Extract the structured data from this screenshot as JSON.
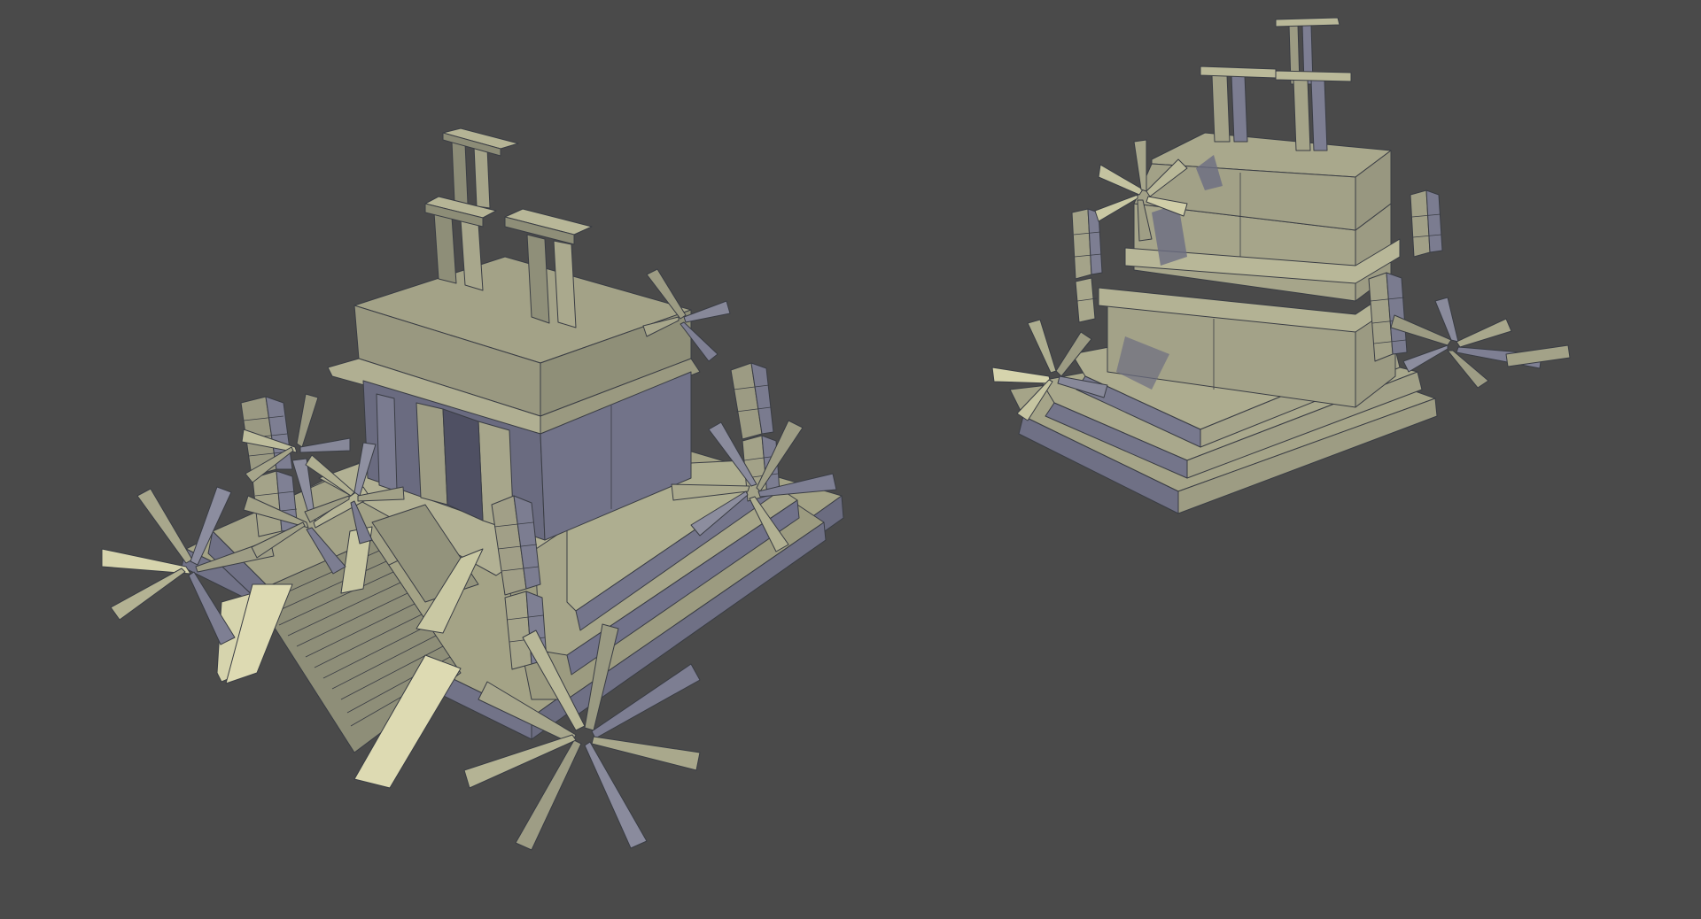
{
  "scene": {
    "background_color": "#4a4a4a",
    "material_light": "#bdbc98",
    "material_mid": "#9f9f83",
    "material_shadow": "#76778c",
    "material_dark": "#63647a",
    "wire_color": "#3a3d44",
    "models": [
      {
        "name": "temple-model-front",
        "pose": "front-three-quarter"
      },
      {
        "name": "temple-model-back",
        "pose": "rear-three-quarter"
      }
    ]
  }
}
